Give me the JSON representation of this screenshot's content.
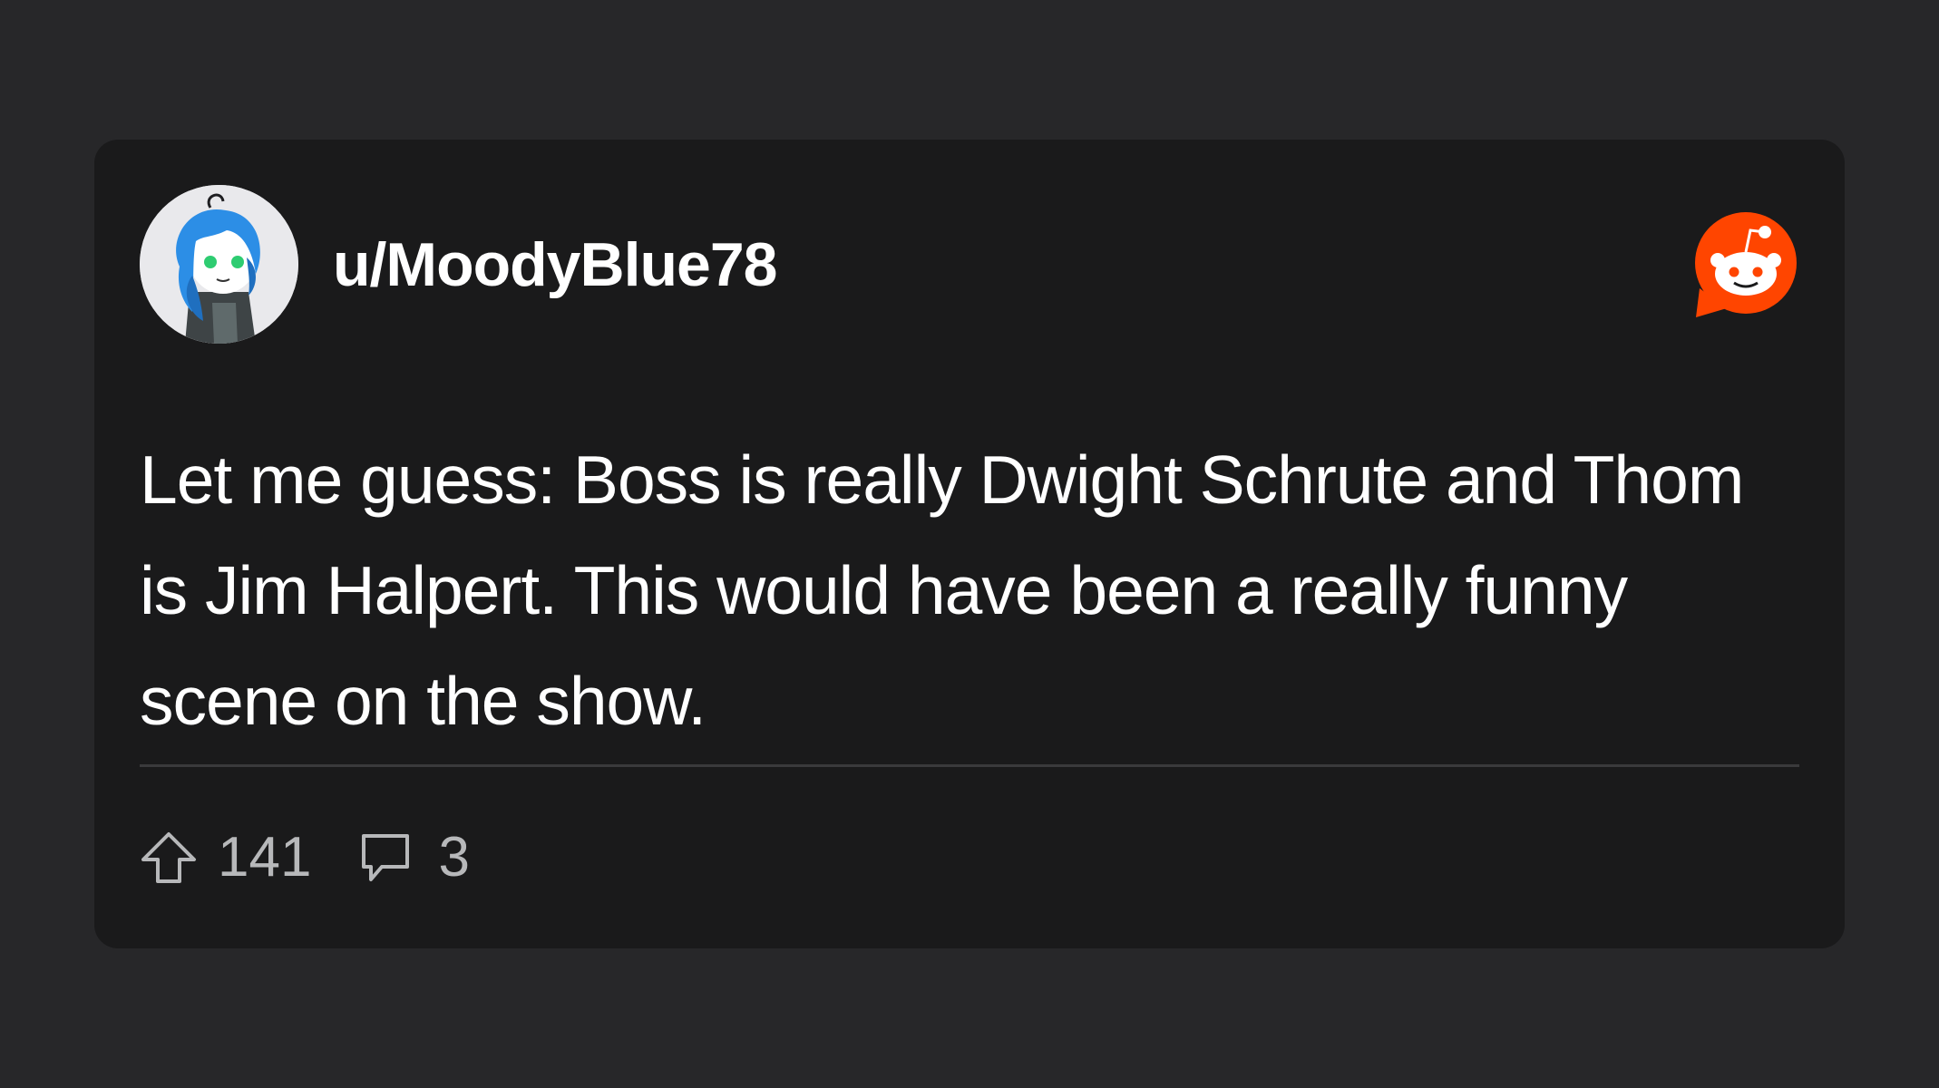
{
  "post": {
    "username": "u/MoodyBlue78",
    "body": "Let me guess: Boss is really Dwight Schrute and Thom is Jim Halpert. This would have been a really funny scene on the show.",
    "upvotes": "141",
    "comments": "3"
  },
  "icons": {
    "avatar": "avatar-illustration",
    "brand": "reddit-logo-icon",
    "upvote": "upvote-arrow-icon",
    "comment": "comment-bubble-icon"
  },
  "colors": {
    "page_background": "#272729",
    "card_background": "#1a1a1b",
    "brand_orange": "#ff4500",
    "text_primary": "#ffffff",
    "text_secondary": "#b7b8ba"
  }
}
